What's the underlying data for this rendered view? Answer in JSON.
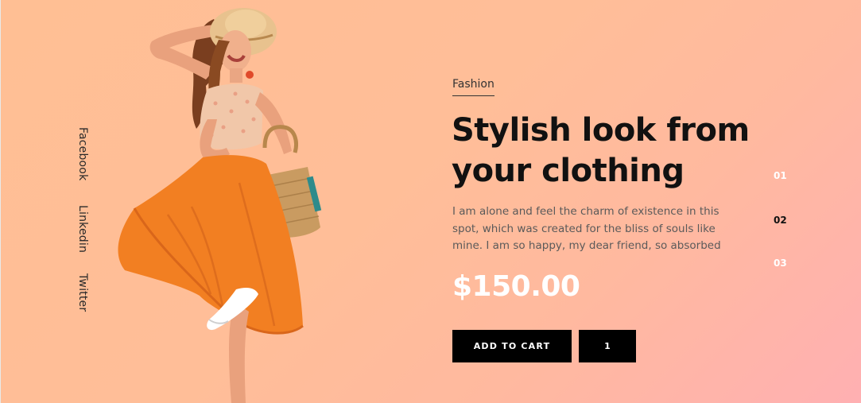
{
  "social": {
    "links": [
      {
        "label": "Facebook"
      },
      {
        "label": "Linkedin"
      },
      {
        "label": "Twitter"
      }
    ]
  },
  "product": {
    "category": "Fashion",
    "title": "Stylish look from your clothing",
    "description": "I am alone and feel the charm of existence in this spot, which was created for the bliss of souls like mine. I am so happy, my dear friend, so absorbed",
    "price": "$150.00",
    "add_to_cart_label": "ADD TO CART",
    "quantity": "1"
  },
  "slider": {
    "numbers": [
      "01",
      "02",
      "03"
    ],
    "active_index": 1
  },
  "colors": {
    "background_start": "#ffbf94",
    "background_end": "#ffb0b2",
    "button": "#000000",
    "price": "#ffffff",
    "dress": "#f57c1f"
  }
}
